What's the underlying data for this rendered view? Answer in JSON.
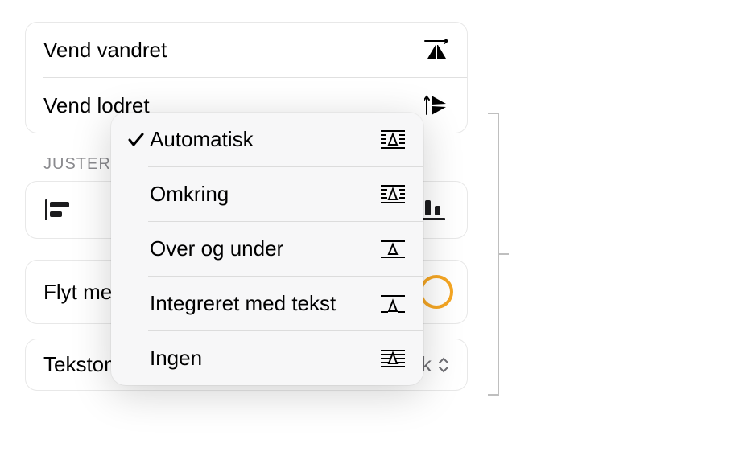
{
  "flip": {
    "horizontal": "Vend vandret",
    "vertical": "Vend lodret"
  },
  "section_header": "JUSTER",
  "move_with_text": "Flyt med tekst",
  "wrap": {
    "label": "Tekstombrydning",
    "value": "Automatisk"
  },
  "popup": {
    "items": [
      {
        "label": "Automatisk",
        "selected": true
      },
      {
        "label": "Omkring",
        "selected": false
      },
      {
        "label": "Over og under",
        "selected": false
      },
      {
        "label": "Integreret med tekst",
        "selected": false
      },
      {
        "label": "Ingen",
        "selected": false
      }
    ]
  }
}
